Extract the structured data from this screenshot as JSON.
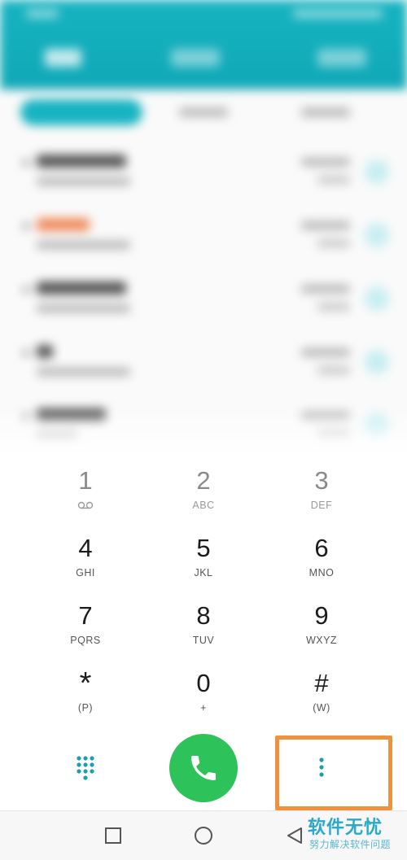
{
  "dialpad": {
    "keys": [
      {
        "digit": "1",
        "letters": ""
      },
      {
        "digit": "2",
        "letters": "ABC"
      },
      {
        "digit": "3",
        "letters": "DEF"
      },
      {
        "digit": "4",
        "letters": "GHI"
      },
      {
        "digit": "5",
        "letters": "JKL"
      },
      {
        "digit": "6",
        "letters": "MNO"
      },
      {
        "digit": "7",
        "letters": "PQRS"
      },
      {
        "digit": "8",
        "letters": "TUV"
      },
      {
        "digit": "9",
        "letters": "WXYZ"
      },
      {
        "digit": "*",
        "letters": "(P)"
      },
      {
        "digit": "0",
        "letters": "+"
      },
      {
        "digit": "#",
        "letters": "(W)"
      }
    ]
  },
  "icons": {
    "voicemail": "voicemail-icon",
    "dialpad_toggle": "dialpad-grid-icon",
    "call": "phone-icon",
    "more": "more-vertical-icon",
    "recents": "square-icon",
    "home": "circle-icon",
    "back": "triangle-back-icon"
  },
  "colors": {
    "accent": "#16b3c1",
    "call_button": "#2ec25a",
    "highlight": "#f0913f",
    "missed_call": "#f08a5d"
  },
  "watermark": {
    "title": "软件无忧",
    "subtitle": "努力解决软件问题"
  }
}
